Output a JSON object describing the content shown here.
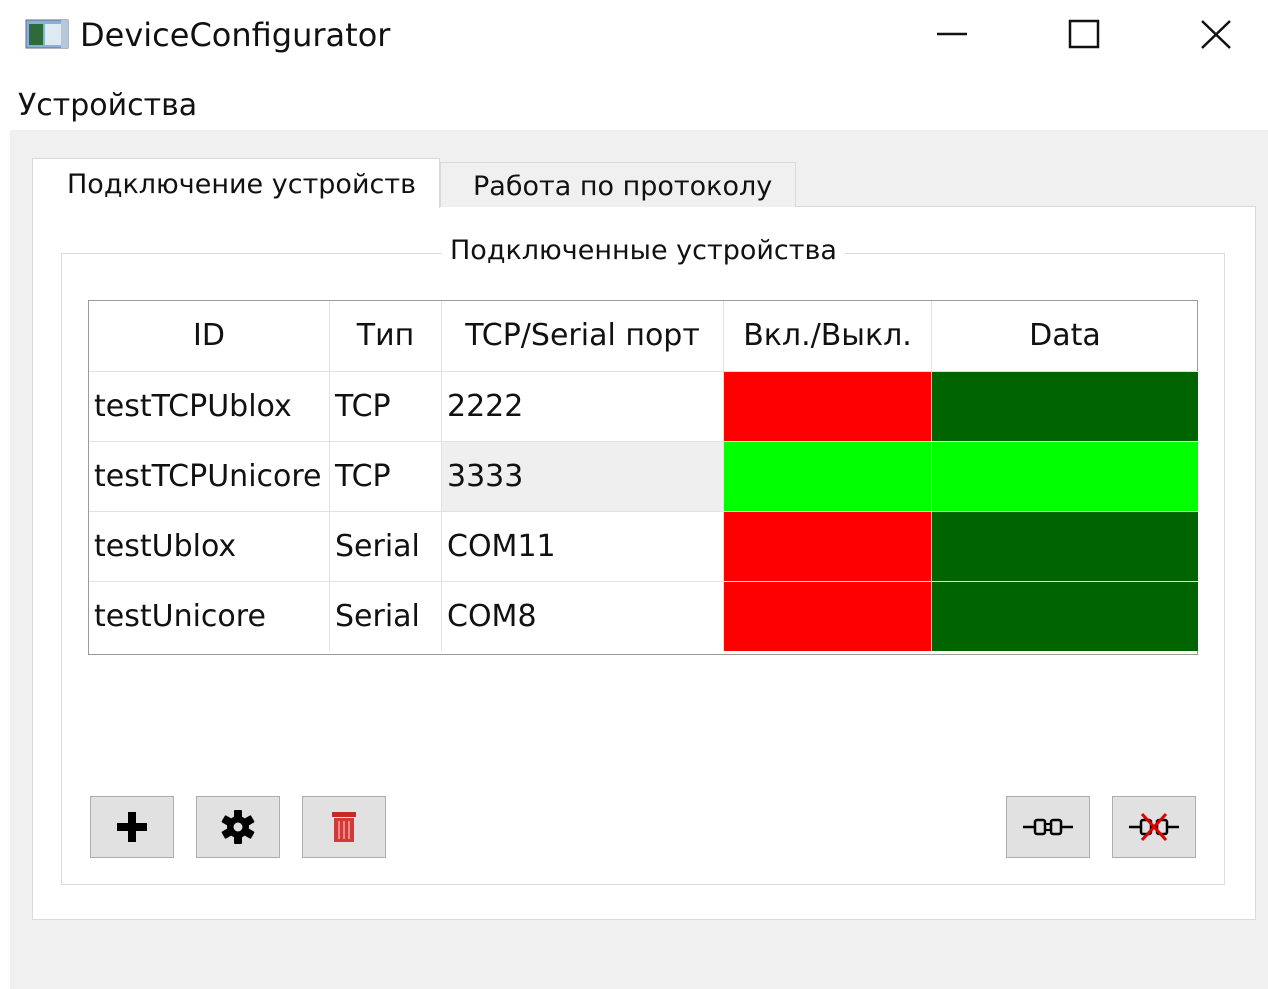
{
  "window": {
    "title": "DeviceConfigurator",
    "icon": "app-window-icon"
  },
  "menu": {
    "items": [
      "Устройства"
    ]
  },
  "tabs": [
    {
      "label": "Подключение устройств",
      "active": true
    },
    {
      "label": "Работа по протоколу",
      "active": false
    }
  ],
  "group": {
    "title": "Подключенные устройства"
  },
  "table": {
    "headers": [
      "ID",
      "Тип",
      "TCP/Serial порт",
      "Вкл./Выкл.",
      "Data"
    ],
    "rows": [
      {
        "id": "testTCPUblox",
        "type": "TCP",
        "port": "2222",
        "power": "off",
        "data": "inactive"
      },
      {
        "id": "testTCPUnicore",
        "type": "TCP",
        "port": "3333",
        "power": "on",
        "data": "active",
        "selected": true
      },
      {
        "id": "testUblox",
        "type": "Serial",
        "port": "COM11",
        "power": "off",
        "data": "inactive"
      },
      {
        "id": "testUnicore",
        "type": "Serial",
        "port": "COM8",
        "power": "off",
        "data": "inactive"
      }
    ]
  },
  "status_colors": {
    "off": "#ff0000",
    "on": "#00ff00",
    "inactive": "#006400",
    "active": "#00ff00",
    "selected_row": "#efefef"
  },
  "buttons": [
    {
      "name": "add-device-button",
      "icon": "plus-icon"
    },
    {
      "name": "settings-button",
      "icon": "gear-icon"
    },
    {
      "name": "delete-button",
      "icon": "trash-icon"
    },
    {
      "name": "connect-button",
      "icon": "plug-connected-icon"
    },
    {
      "name": "disconnect-button",
      "icon": "plug-disconnected-icon"
    }
  ]
}
